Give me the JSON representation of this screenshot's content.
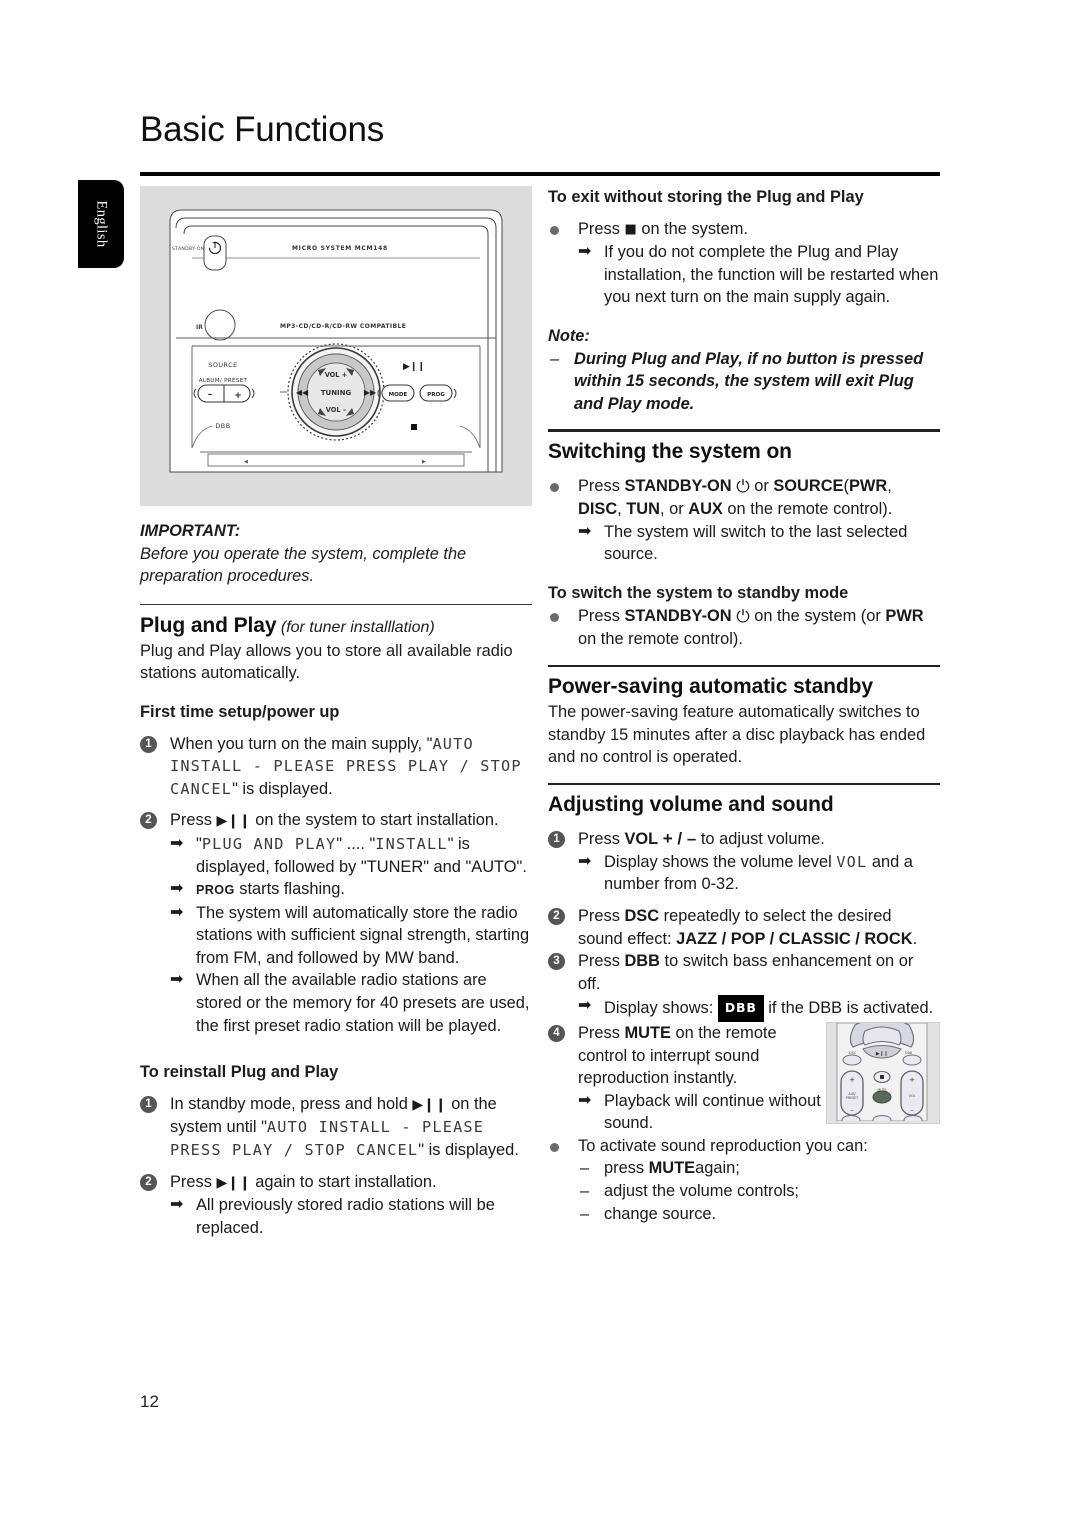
{
  "page": {
    "title": "Basic Functions",
    "language_tab": "English",
    "number": "12"
  },
  "figure_device": {
    "standby_label": "STANDBY-ON",
    "model_label": "MICRO SYSTEM MCM148",
    "ir_label": "IR",
    "disc_label": "MP3-CD/CD-R/CD-RW COMPATIBLE",
    "source_label": "SOURCE",
    "album_preset_label": "ALBUM/ PRESET",
    "dbb_label": "DBB",
    "vol_plus_label": "VOL +",
    "vol_minus_label": "VOL –",
    "tuning_label": "TUNING",
    "mode_label": "MODE",
    "prog_label": "PROG",
    "minus_label": "–",
    "plus_label": "+"
  },
  "left": {
    "important_head": "IMPORTANT:",
    "important_body": "Before you operate the system, complete the preparation procedures.",
    "plug_play_head": "Plug and Play",
    "plug_play_head_sub": "(for tuner installlation)",
    "plug_play_body": "Plug and Play allows you to store all available radio stations automatically.",
    "first_time_head": "First time setup/power up",
    "step1_pre": "When you turn on the main supply, \"",
    "step1_lcd1": "AUTO INSTALL - PLEASE PRESS PLAY / STOP CANCEL",
    "step1_post": "\" is displayed.",
    "step2_pre": "Press",
    "step2_post": "on the system to start installation.",
    "step2_a_pre": "\"",
    "step2_a_lcd1": "PLUG AND PLAY",
    "step2_a_mid": "\" .... \"",
    "step2_a_lcd2": "INSTALL",
    "step2_a_post": "\" is displayed, followed by \"TUNER\" and \"AUTO\".",
    "step2_b_prog": "PROG",
    "step2_b_post": "starts flashing.",
    "step2_c": "The system will automatically store the radio stations with sufficient signal strength, starting from FM, and followed by MW band.",
    "step2_d": "When all the available radio stations are stored or the memory for 40 presets are used, the first preset radio station will be played.",
    "reinstall_head": "To reinstall Plug and Play",
    "re_step1_pre": "In standby mode, press and hold",
    "re_step1_mid": "on the system until \"",
    "re_step1_lcd": "AUTO INSTALL - PLEASE PRESS PLAY / STOP CANCEL",
    "re_step1_post": "\" is displayed.",
    "re_step2_pre": "Press",
    "re_step2_post": "again to start installation.",
    "re_step2_a": "All previously stored radio stations will be replaced."
  },
  "right": {
    "exit_head": "To exit without storing the Plug and Play",
    "exit_press_pre": "Press",
    "exit_press_post": "on the system.",
    "exit_arrow": "If you do not complete the Plug and Play installation, the function will be restarted when you next turn on the main supply again.",
    "note_head": "Note:",
    "note_body": "During Plug and Play, if no button is pressed within 15 seconds, the system will exit Plug and Play mode.",
    "switch_on_head": "Switching the system on",
    "switch_on_press_pre": "Press",
    "switch_on_standby": "STANDBY-ON",
    "switch_on_mid": "or",
    "switch_on_source": "SOURCE",
    "switch_on_paren_open": "(",
    "switch_on_pwr": "PWR",
    "switch_on_comma1": ",",
    "switch_on_disc": "DISC",
    "switch_on_comma2": ",",
    "switch_on_tun": "TUN",
    "switch_on_or": ", or",
    "switch_on_aux": "AUX",
    "switch_on_tail": "on the remote control).",
    "switch_on_arrow": "The system will switch to the last selected source.",
    "standby_head": "To switch the system to standby mode",
    "standby_press_pre": "Press",
    "standby_label": "STANDBY-ON",
    "standby_mid": "on the system (or",
    "standby_pwr": "PWR",
    "standby_tail": "on the  remote control).",
    "powersave_head": "Power-saving automatic standby",
    "powersave_body": "The power-saving feature automatically switches to standby 15 minutes after a disc playback has ended and no control is operated.",
    "volume_head": "Adjusting volume and sound",
    "vol_step1_pre": "Press",
    "vol_step1_vol": "VOL",
    "vol_step1_signs": "+ / –",
    "vol_step1_post": "to adjust volume.",
    "vol_step1_a_pre": "Display shows the volume level",
    "vol_step1_a_lcd": "VOL",
    "vol_step1_a_post": "and a number from 0-32.",
    "vol_step2_pre": "Press",
    "vol_step2_dsc": "DSC",
    "vol_step2_mid": "repeatedly to select the desired sound effect:",
    "vol_step2_effects": "JAZZ / POP / CLASSIC / ROCK",
    "vol_step2_post": ".",
    "vol_step3_pre": "Press",
    "vol_step3_dbb": "DBB",
    "vol_step3_post": "to switch bass enhancement on or off.",
    "vol_step3_a_pre": "Display shows:",
    "vol_step3_a_badge": "DBB",
    "vol_step3_a_post": "if the DBB is activated.",
    "vol_step4_pre": "Press",
    "vol_step4_mute": "MUTE",
    "vol_step4_post": "on the remote control to interrupt sound reproduction instantly.",
    "vol_step4_a": "Playback will continue without sound.",
    "activate_bullet": "To activate sound reproduction you can:",
    "activate_1_pre": "press",
    "activate_1_mute": "MUTE",
    "activate_1_post": "again;",
    "activate_2": "adjust the volume controls;",
    "activate_3": "change source."
  },
  "icons": {
    "play_pause": "play-pause-icon",
    "stop": "stop-icon",
    "power": "power-icon",
    "arrow": "arrow-right-icon"
  }
}
